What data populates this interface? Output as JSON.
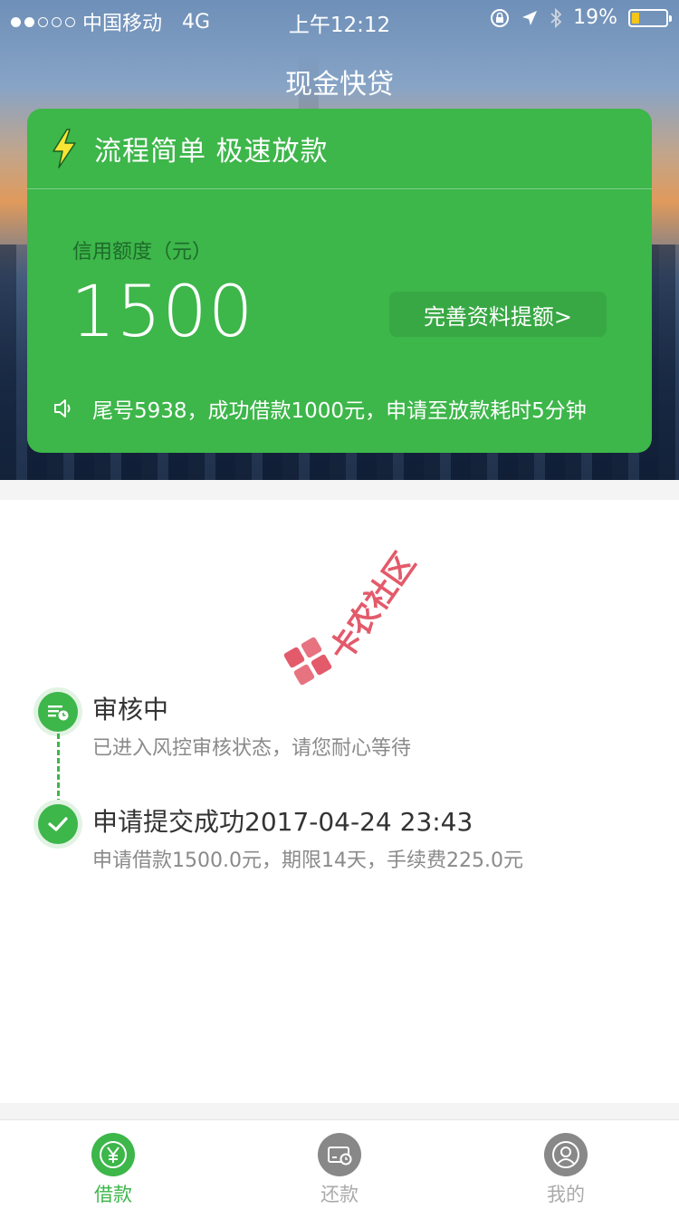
{
  "status_bar": {
    "carrier": "中国移动",
    "network": "4G",
    "time": "上午12:12",
    "battery_percent": "19%",
    "battery_level": 0.19,
    "signal_bars": 2
  },
  "nav": {
    "title": "现金快贷"
  },
  "card": {
    "slogan": "流程简单 极速放款",
    "limit_label": "信用额度（元）",
    "amount": "1500",
    "raise_button": "完善资料提额>",
    "notice": "尾号5938，成功借款1000元，申请至放款耗时5分钟",
    "color": "#3db64a"
  },
  "watermark": {
    "text": "卡农社区"
  },
  "timeline": [
    {
      "title": "审核中",
      "subtitle": "已进入风控审核状态，请您耐心等待",
      "icon": "document-clock-icon"
    },
    {
      "title": "申请提交成功2017-04-24 23:43",
      "subtitle": "申请借款1500.0元，期限14天，手续费225.0元",
      "icon": "check-icon"
    }
  ],
  "tabs": [
    {
      "label": "借款",
      "icon": "yuan-icon",
      "active": true
    },
    {
      "label": "还款",
      "icon": "card-clock-icon",
      "active": false
    },
    {
      "label": "我的",
      "icon": "user-icon",
      "active": false
    }
  ]
}
